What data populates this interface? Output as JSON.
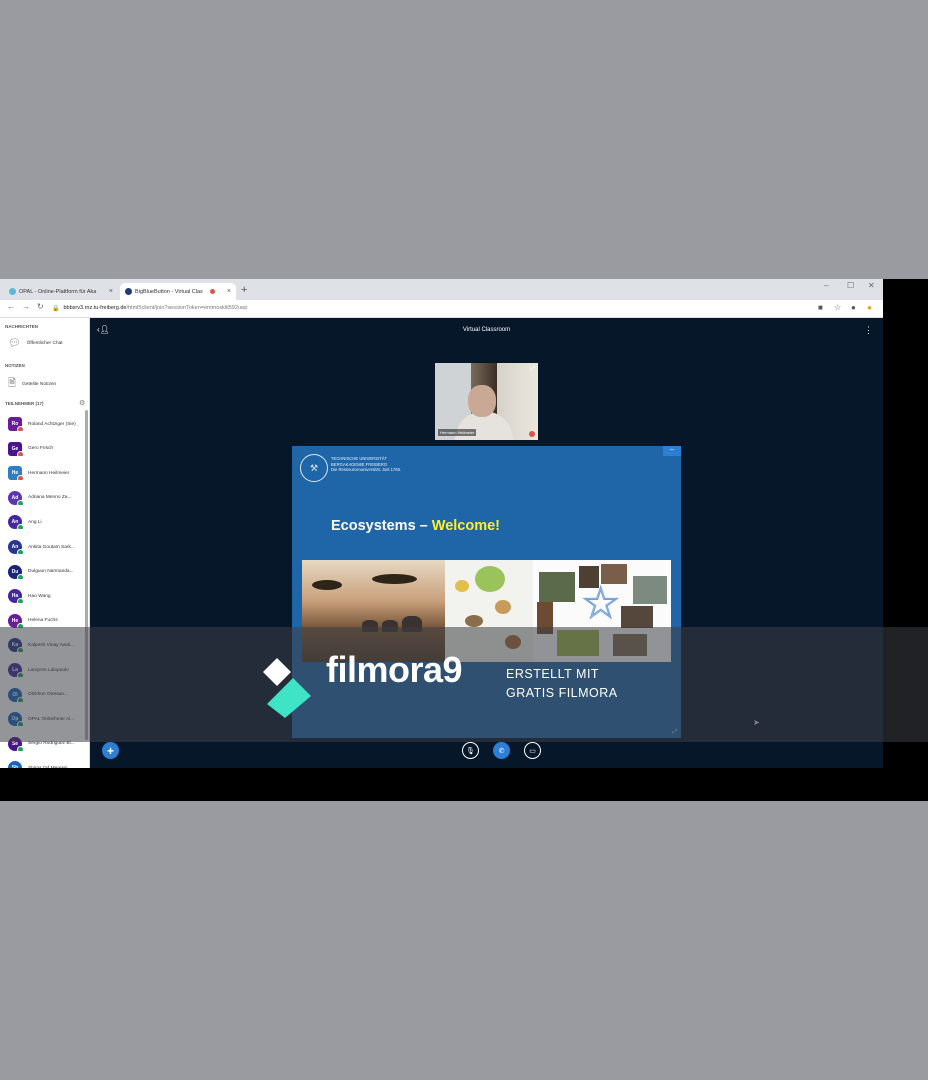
{
  "browser": {
    "tabs": [
      {
        "label": "OPAL - Online-Plattform für Aka",
        "active": false
      },
      {
        "label": "BigBlueButton - Virtual Clas",
        "active": true
      }
    ],
    "new_tab": "+",
    "close": "×",
    "window_controls": [
      "–",
      "☐",
      "✕"
    ],
    "url_host": "bbbsrv3.rnz.tu-freiberg.de",
    "url_path": "/html5client/join?sessionToken=emmosklit592uwz"
  },
  "sidebar": {
    "messages_header": "NACHRICHTEN",
    "public_chat": "Öffentlicher Chat",
    "notes_header": "NOTIZEN",
    "shared_notes": "Geteilte Notizen",
    "participants_header": "TEILNEHMER (17)",
    "users": [
      {
        "initials": "Ro",
        "name": "Roland Achtziger (Sie)",
        "color": "#6a1b9a",
        "square": true,
        "status": "#d9534f"
      },
      {
        "initials": "Ge",
        "name": "Gero Frisch",
        "color": "#4a148c",
        "square": true,
        "status": "#d9534f"
      },
      {
        "initials": "He",
        "name": "Hermann Heilmeier",
        "color": "#2f7fc1",
        "square": true,
        "status": "#d9534f"
      },
      {
        "initials": "Ad",
        "name": "Adriana Menno Za...",
        "color": "#5e35b1",
        "square": false,
        "status": "#1aa35c"
      },
      {
        "initials": "An",
        "name": "Ang Li",
        "color": "#4527a0",
        "square": false,
        "status": "#1aa35c"
      },
      {
        "initials": "An",
        "name": "Ankita Goutam Sark...",
        "color": "#283593",
        "square": false,
        "status": "#1aa35c"
      },
      {
        "initials": "Du",
        "name": "Dulguun Narmanda...",
        "color": "#1a237e",
        "square": false,
        "status": "#1aa35c"
      },
      {
        "initials": "Ha",
        "name": "Hao Wang",
        "color": "#4527a0",
        "square": false,
        "status": "#1aa35c"
      },
      {
        "initials": "He",
        "name": "Helena Fuchs",
        "color": "#6a1b9a",
        "square": false,
        "status": "#1aa35c"
      },
      {
        "initials": "Ka",
        "name": "Kalpesh Vinay Awal...",
        "color": "#283593",
        "square": false,
        "status": "#1aa35c"
      },
      {
        "initials": "La",
        "name": "Lampros Lalopoulo",
        "color": "#4527a0",
        "square": false,
        "status": "#1aa35c"
      },
      {
        "initials": "Ol",
        "name": "Olzkhon Otorsan...",
        "color": "#1565c0",
        "square": false,
        "status": "#1aa35c"
      },
      {
        "initials": "Op",
        "name": "OPAL Teilnehmer Al...",
        "color": "#1565c0",
        "square": false,
        "status": "#1aa35c"
      },
      {
        "initials": "Se",
        "name": "Sergio Rodriguez Bl...",
        "color": "#4a148c",
        "square": false,
        "status": "#1aa35c"
      },
      {
        "initials": "Sh",
        "name": "Shiros Od Meressi...",
        "color": "#1565c0",
        "square": false,
        "status": "#1aa35c"
      }
    ]
  },
  "main": {
    "title": "Virtual Classroom",
    "webcam_name": "Hermann Heilmeier"
  },
  "slide": {
    "uni_line1": "TECHNISCHE UNIVERSITÄT",
    "uni_line2": "BERGAKADEMIE FREIBERG",
    "uni_line3": "Die Ressourcenuniversität. Seit 1765.",
    "title_main": "Ecosystems – ",
    "title_highlight": "Welcome!"
  },
  "watermark": {
    "brand": "filmora9",
    "line1": "ERSTELLT MIT",
    "line2": "GRATIS FILMORA"
  },
  "colors": {
    "bbb_dark": "#06172a",
    "bbb_blue": "#2d7fd6",
    "slide_blue": "#1f66a8",
    "highlight_yellow": "#ffef2b"
  }
}
